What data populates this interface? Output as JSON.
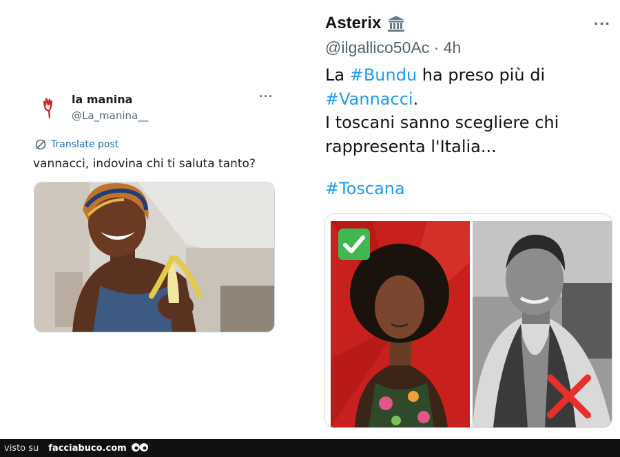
{
  "left_tweet": {
    "display_name": "la manina",
    "handle": "@La_manina__",
    "more_label": "···",
    "translate_label": "Translate post",
    "text": "vannacci, indovina chi ti saluta tanto?",
    "media_icon": "photo-woman-with-banana"
  },
  "right_tweet": {
    "display_name": "Asterix",
    "badge_icon": "government-building-icon",
    "more_label": "···",
    "handle": "@ilgallico50Ac",
    "separator": "·",
    "time": "4h",
    "body": {
      "line1_prefix": "La ",
      "line1_tag": "#Bundu",
      "line1_suffix": " ha preso più di",
      "line2_tag": "#Vannacci",
      "line2_suffix": ".",
      "line3": "I toscani sanno scegliere chi",
      "line4": "rappresenta l'Italia..."
    },
    "hashtag": "#Toscana",
    "media": {
      "left_icon": "check-mark-icon",
      "right_icon": "cross-mark-icon"
    }
  },
  "footer": {
    "label": "visto su",
    "site": "facciabuco.com"
  },
  "colors": {
    "link": "#1d9bf0",
    "muted": "#536471",
    "red_bg": "#c8201e",
    "check_green": "#3fb94f"
  }
}
